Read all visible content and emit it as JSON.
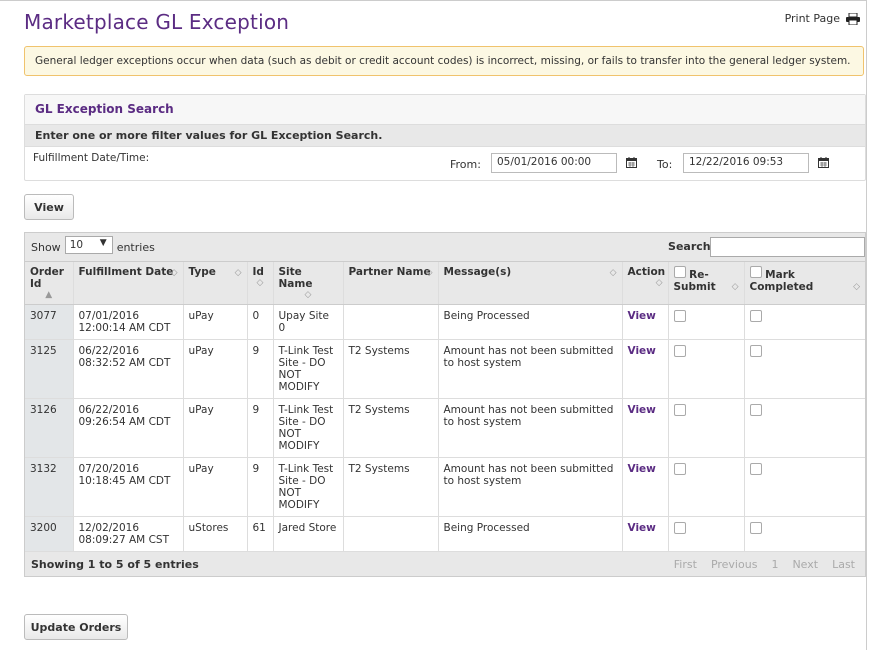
{
  "page": {
    "title": "Marketplace GL Exception",
    "print_label": "Print Page",
    "alert_text": "General ledger exceptions occur when data (such as debit or credit account codes) is incorrect, missing, or fails to transfer into the general ledger system."
  },
  "search_panel": {
    "heading": "GL Exception Search",
    "instructions": "Enter one or more filter values for GL Exception Search.",
    "field_label": "Fulfillment Date/Time:",
    "from_label": "From:",
    "from_value": "05/01/2016 00:00",
    "to_label": "To:",
    "to_value": "12/22/2016 09:53",
    "view_button": "View"
  },
  "grid": {
    "show_label": "Show",
    "entries_value": "10",
    "entries_label": "entries",
    "search_label": "Search:",
    "columns": [
      "Order Id",
      "Fulfillment Date",
      "Type",
      "Id",
      "Site Name",
      "Partner Name",
      "Message(s)",
      "Action",
      "Re-Submit",
      "Mark Completed"
    ],
    "rows": [
      {
        "order_id": "3077",
        "date": "07/01/2016 12:00:14 AM CDT",
        "type": "uPay",
        "id": "0",
        "site": "Upay Site 0",
        "partner": "",
        "message": "Being Processed",
        "action": "View"
      },
      {
        "order_id": "3125",
        "date": "06/22/2016 08:32:52 AM CDT",
        "type": "uPay",
        "id": "9",
        "site": "T-Link Test Site - DO NOT MODIFY",
        "partner": "T2 Systems",
        "message": "Amount has not been submitted to host system",
        "action": "View"
      },
      {
        "order_id": "3126",
        "date": "06/22/2016 09:26:54 AM CDT",
        "type": "uPay",
        "id": "9",
        "site": "T-Link Test Site - DO NOT MODIFY",
        "partner": "T2 Systems",
        "message": "Amount has not been submitted to host system",
        "action": "View"
      },
      {
        "order_id": "3132",
        "date": "07/20/2016 10:18:45 AM CDT",
        "type": "uPay",
        "id": "9",
        "site": "T-Link Test Site - DO NOT MODIFY",
        "partner": "T2 Systems",
        "message": "Amount has not been submitted to host system",
        "action": "View"
      },
      {
        "order_id": "3200",
        "date": "12/02/2016 08:09:27 AM CST",
        "type": "uStores",
        "id": "61",
        "site": "Jared Store",
        "partner": "",
        "message": "Being Processed",
        "action": "View"
      }
    ],
    "showing_text": "Showing 1 to 5 of 5 entries",
    "pager": {
      "first": "First",
      "previous": "Previous",
      "page": "1",
      "next": "Next",
      "last": "Last"
    }
  },
  "update_button": "Update Orders",
  "colors": {
    "brand": "#5b2c83",
    "alert_bg": "#fcf8e3",
    "alert_border": "#f0c36d"
  }
}
